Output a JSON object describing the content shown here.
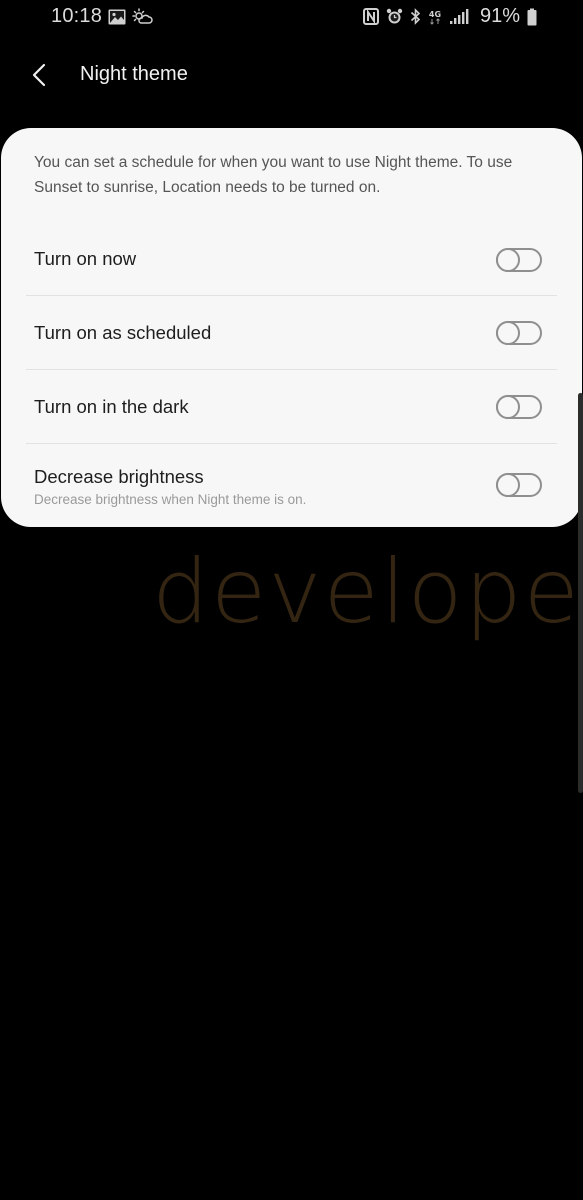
{
  "status_bar": {
    "time": "10:18",
    "left_icons": [
      "gallery-notification-icon",
      "weather-icon"
    ],
    "right_icons": [
      "nfc-icon",
      "alarm-icon",
      "bluetooth-icon",
      "data-4g-icon",
      "signal-icon",
      "battery-icon"
    ],
    "battery_percent": "91%"
  },
  "app_bar": {
    "back_icon": "chevron-left-icon",
    "title": "Night theme"
  },
  "card": {
    "description": "You can set a schedule for when you want to use Night theme. To use Sunset to sunrise, Location needs to be turned on.",
    "settings": [
      {
        "label": "Turn on now",
        "sublabel": "",
        "enabled": false
      },
      {
        "label": "Turn on as scheduled",
        "sublabel": "",
        "enabled": false
      },
      {
        "label": "Turn on in the dark",
        "sublabel": "",
        "enabled": false
      },
      {
        "label": "Decrease brightness",
        "sublabel": "Decrease brightness when Night theme is on.",
        "enabled": false
      }
    ]
  },
  "watermark": {
    "text": "developers",
    "color": "#3a2a14"
  },
  "colors": {
    "background": "#000000",
    "card": "#f7f7f7",
    "toggle_off": "#8f8f8f",
    "primary_text": "#1e1e1e",
    "secondary_text": "#9a9a9a"
  }
}
